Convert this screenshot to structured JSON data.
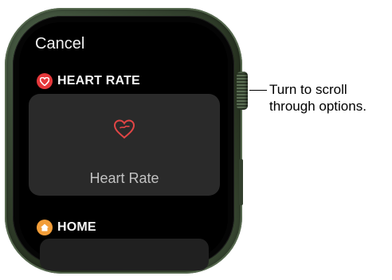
{
  "screen": {
    "cancel_label": "Cancel",
    "sections": [
      {
        "title": "HEART RATE",
        "icon": "heart-icon",
        "color": "#e5383b",
        "item_label": "Heart Rate"
      },
      {
        "title": "HOME",
        "icon": "home-icon",
        "color": "#f29d38"
      }
    ]
  },
  "callout": {
    "line1": "Turn to scroll",
    "line2": "through options."
  }
}
